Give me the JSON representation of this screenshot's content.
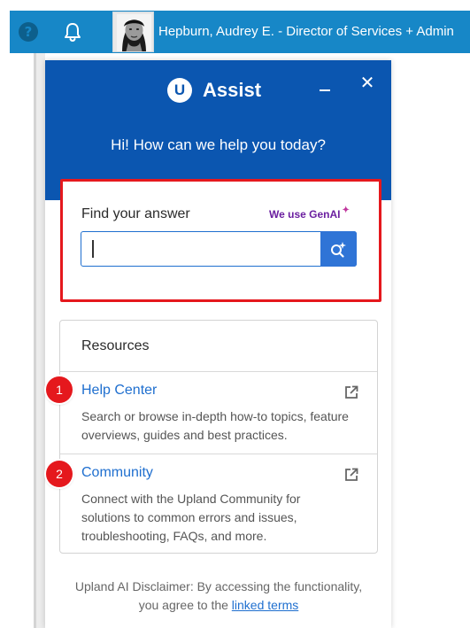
{
  "topbar": {
    "help_icon": "question-circle-icon",
    "bell_icon": "bell-icon",
    "user_label": "Hepburn, Audrey E. - Director of Services + Admin",
    "bar_color": "#1787c7"
  },
  "assist": {
    "logo_letter": "U",
    "title": "Assist",
    "greeting": "Hi! How can we help you today?",
    "header_color": "#0b56b0"
  },
  "find": {
    "label": "Find your answer",
    "genai_label": "We use GenAI",
    "genai_spark": "✦",
    "search_value": "",
    "search_placeholder": "",
    "highlight_color": "#e5181d"
  },
  "resources": {
    "title": "Resources",
    "items": [
      {
        "step": "1",
        "label": "Help Center",
        "description": "Search or browse in-depth how-to topics, feature overviews, guides and best practices.",
        "icon": "external-link-icon"
      },
      {
        "step": "2",
        "label": "Community",
        "description": "Connect with the Upland Community for solutions to common errors and issues, troubleshooting, FAQs, and more.",
        "icon": "external-link-icon"
      }
    ]
  },
  "disclaimer": {
    "text": "Upland AI Disclaimer: By accessing the functionality, you agree to the",
    "link_text": "linked terms"
  }
}
